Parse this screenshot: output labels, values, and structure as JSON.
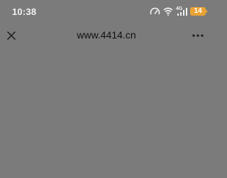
{
  "status_bar": {
    "time": "10:38",
    "network": "4G",
    "battery_level": "14",
    "icons": [
      "speed-meter-icon",
      "wifi-icon",
      "signal-4g-icon",
      "battery-icon"
    ],
    "battery_color": "#e9a234"
  },
  "nav_bar": {
    "title": "www.4414.cn",
    "close_icon": "close-icon",
    "more_icon": "more-icon"
  },
  "theme": {
    "background": "#7b7b7b",
    "title_color": "#111111"
  }
}
